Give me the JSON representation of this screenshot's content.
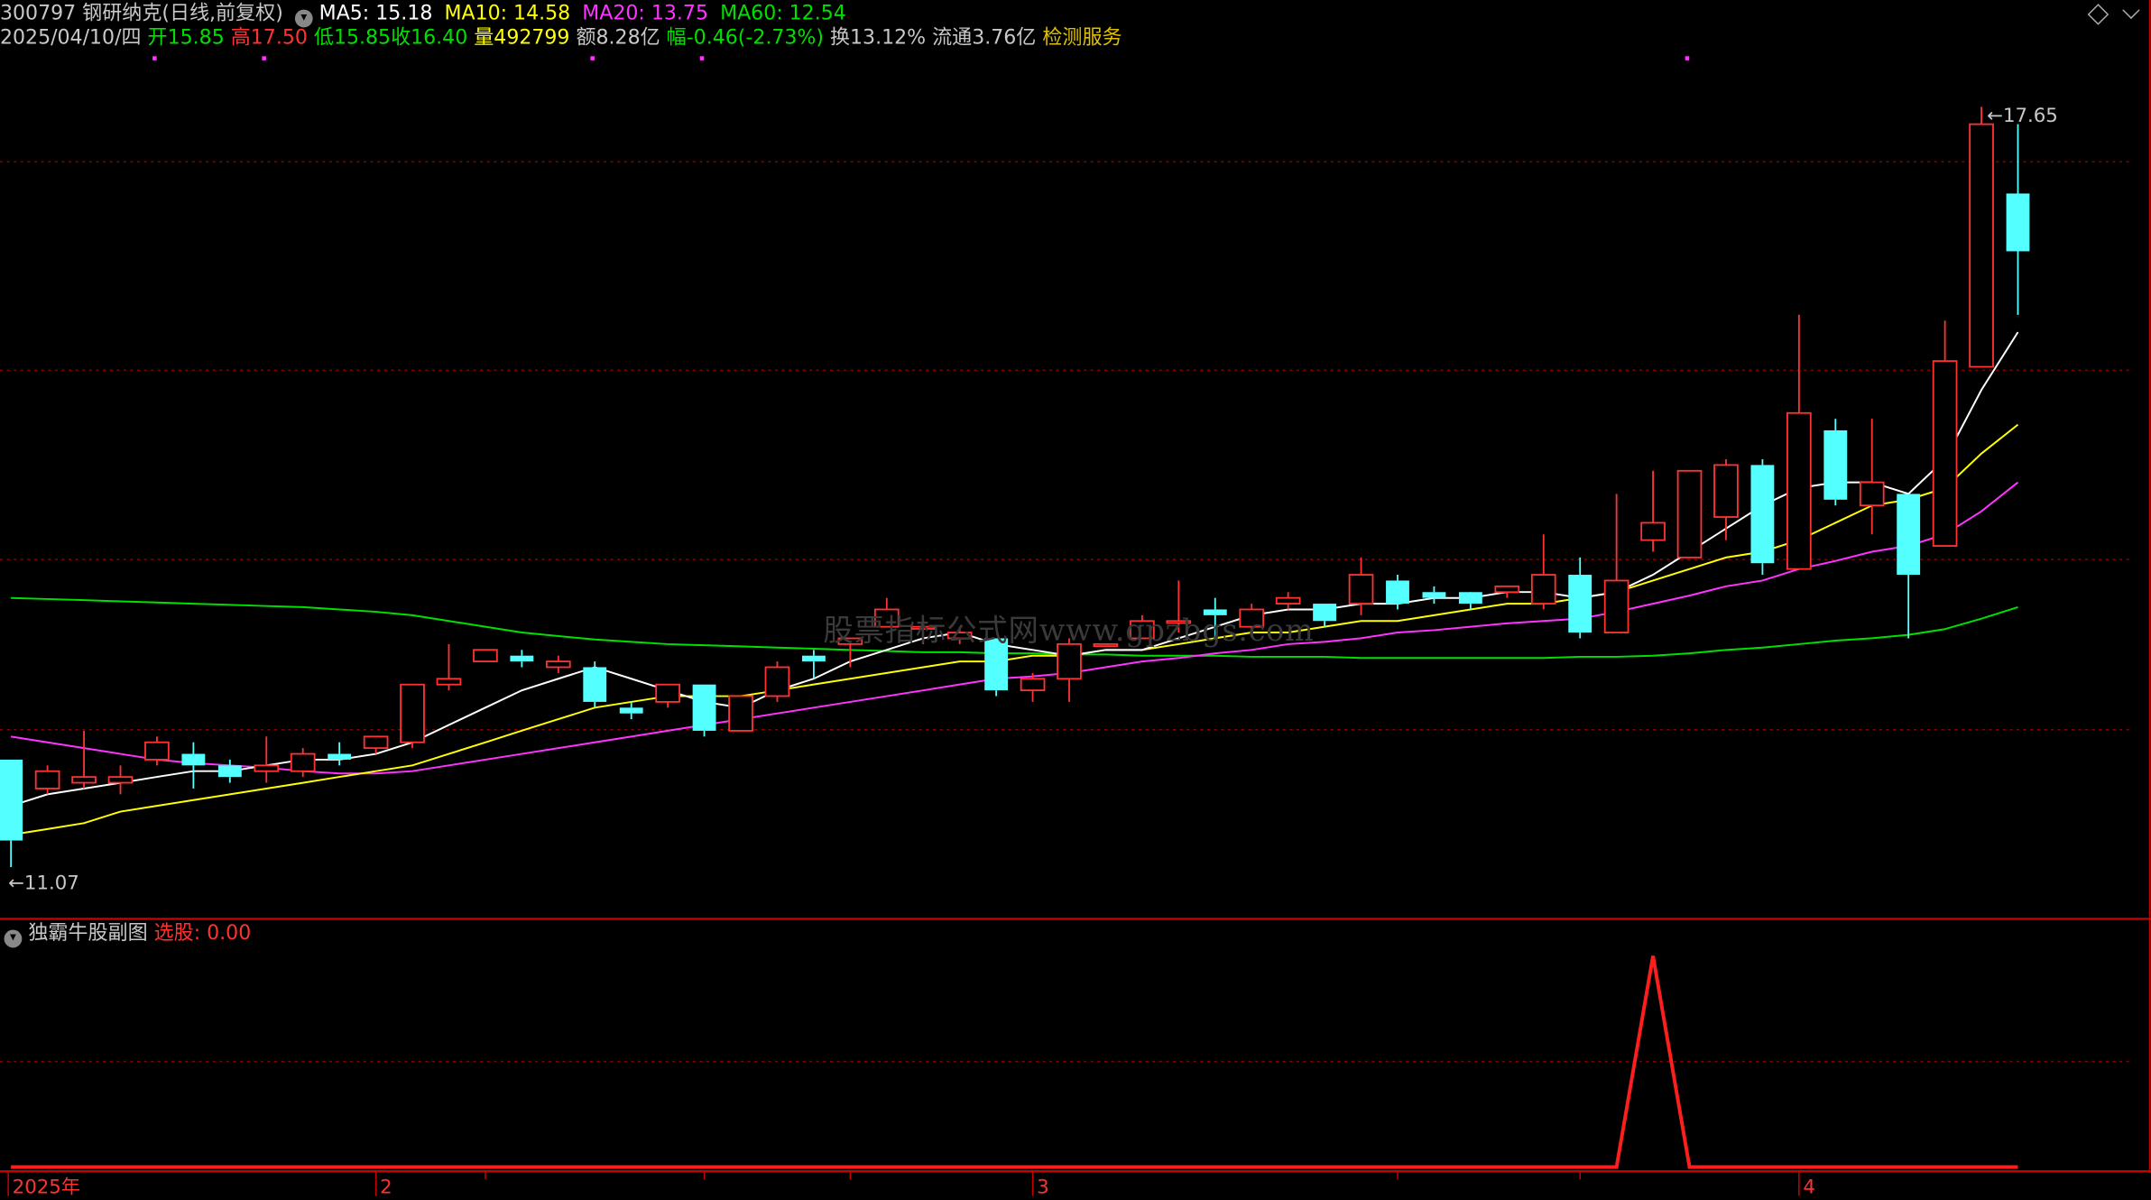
{
  "header": {
    "code": "300797",
    "name": "钢研纳克",
    "period": "(日线,前复权)",
    "ma_labels": [
      {
        "label": "MA5:",
        "value": "15.18",
        "color": "#ffffff"
      },
      {
        "label": "MA10:",
        "value": "14.58",
        "color": "#ffff00"
      },
      {
        "label": "MA20:",
        "value": "13.75",
        "color": "#ff33ff"
      },
      {
        "label": "MA60:",
        "value": "12.54",
        "color": "#00e000"
      }
    ],
    "date": "2025/04/10/四",
    "open_label": "开",
    "open": "15.85",
    "high_label": "高",
    "high": "17.50",
    "low_label": "低",
    "low": "15.85",
    "close_label": "收",
    "close": "16.40",
    "vol_label": "量",
    "vol": "492799",
    "amount_label": "额",
    "amount": "8.28亿",
    "chg_label": "幅",
    "chg": "-0.46(-2.73%)",
    "turnover_label": "换",
    "turnover": "13.12%",
    "float_label": "流通",
    "float": "3.76亿",
    "service": "检测服务"
  },
  "indicator": {
    "name": "独霸牛股副图",
    "label": "选股:",
    "value": "0.00"
  },
  "watermark": "股票指标公式网www.gpzbgs.com",
  "colors": {
    "up": "#ff3232",
    "down": "#54ffff",
    "grid": "#8a0000",
    "ma5": "#ffffff",
    "ma10": "#ffff00",
    "ma20": "#ff33ff",
    "ma60": "#00e000",
    "axis": "#c80000"
  },
  "chart_data": {
    "type": "candlestick",
    "price_range": [
      10.8,
      18.1
    ],
    "high_label": "17.65",
    "low_label": "11.07",
    "x_labels": [
      "2025年",
      "2",
      "3",
      "4"
    ],
    "x_label_index": [
      0,
      10,
      28,
      49
    ],
    "candles": [
      [
        12.0,
        11.3,
        12.0,
        11.07
      ],
      [
        11.75,
        11.9,
        11.95,
        11.7
      ],
      [
        11.8,
        11.85,
        12.25,
        11.75
      ],
      [
        11.8,
        11.85,
        11.95,
        11.7
      ],
      [
        12.0,
        12.15,
        12.2,
        11.95
      ],
      [
        12.05,
        11.95,
        12.15,
        11.75
      ],
      [
        11.95,
        11.85,
        12.0,
        11.8
      ],
      [
        11.9,
        11.95,
        12.2,
        11.8
      ],
      [
        11.9,
        12.05,
        12.1,
        11.85
      ],
      [
        12.05,
        12.0,
        12.15,
        11.95
      ],
      [
        12.1,
        12.2,
        12.2,
        12.05
      ],
      [
        12.15,
        12.65,
        12.65,
        12.1
      ],
      [
        12.65,
        12.7,
        13.0,
        12.6
      ],
      [
        12.85,
        12.95,
        12.95,
        12.85
      ],
      [
        12.9,
        12.85,
        12.95,
        12.8
      ],
      [
        12.8,
        12.85,
        12.9,
        12.75
      ],
      [
        12.8,
        12.5,
        12.85,
        12.45
      ],
      [
        12.45,
        12.4,
        12.5,
        12.35
      ],
      [
        12.5,
        12.65,
        12.65,
        12.45
      ],
      [
        12.65,
        12.25,
        12.65,
        12.2
      ],
      [
        12.25,
        12.55,
        12.55,
        12.25
      ],
      [
        12.55,
        12.8,
        12.85,
        12.5
      ],
      [
        12.9,
        12.85,
        12.95,
        12.7
      ],
      [
        13.0,
        13.05,
        13.05,
        12.8
      ],
      [
        13.15,
        13.3,
        13.4,
        13.15
      ],
      [
        13.15,
        13.15,
        13.2,
        13.0
      ],
      [
        13.05,
        13.1,
        13.15,
        13.0
      ],
      [
        13.05,
        12.6,
        13.05,
        12.55
      ],
      [
        12.6,
        12.7,
        12.75,
        12.5
      ],
      [
        12.7,
        13.0,
        13.05,
        12.5
      ],
      [
        13.0,
        13.0,
        13.0,
        13.0
      ],
      [
        13.05,
        13.2,
        13.25,
        13.05
      ],
      [
        13.2,
        13.2,
        13.55,
        13.1
      ],
      [
        13.3,
        13.25,
        13.4,
        13.05
      ],
      [
        13.15,
        13.3,
        13.35,
        13.1
      ],
      [
        13.35,
        13.4,
        13.45,
        13.3
      ],
      [
        13.35,
        13.2,
        13.35,
        13.15
      ],
      [
        13.35,
        13.6,
        13.75,
        13.25
      ],
      [
        13.55,
        13.35,
        13.6,
        13.3
      ],
      [
        13.45,
        13.4,
        13.5,
        13.35
      ],
      [
        13.45,
        13.35,
        13.4,
        13.3
      ],
      [
        13.45,
        13.5,
        13.5,
        13.4
      ],
      [
        13.35,
        13.6,
        13.95,
        13.3
      ],
      [
        13.6,
        13.1,
        13.75,
        13.05
      ],
      [
        13.1,
        13.55,
        14.3,
        13.1
      ],
      [
        13.9,
        14.05,
        14.5,
        13.8
      ],
      [
        13.75,
        14.5,
        14.5,
        13.75
      ],
      [
        14.1,
        14.55,
        14.6,
        13.9
      ],
      [
        14.55,
        13.7,
        14.6,
        13.6
      ],
      [
        13.65,
        15.0,
        15.85,
        13.65
      ],
      [
        14.85,
        14.25,
        14.95,
        14.2
      ],
      [
        14.2,
        14.4,
        14.95,
        13.95
      ],
      [
        14.3,
        13.6,
        14.3,
        13.05
      ],
      [
        13.85,
        15.45,
        15.8,
        13.85
      ],
      [
        15.4,
        17.5,
        17.65,
        15.4
      ],
      [
        16.9,
        16.4,
        17.5,
        15.85
      ]
    ],
    "ma5": [
      11.6,
      11.7,
      11.75,
      11.8,
      11.85,
      11.9,
      11.9,
      11.95,
      12.0,
      12.0,
      12.05,
      12.15,
      12.3,
      12.45,
      12.6,
      12.7,
      12.8,
      12.7,
      12.6,
      12.5,
      12.45,
      12.6,
      12.7,
      12.85,
      12.95,
      13.05,
      13.1,
      13.0,
      12.95,
      12.9,
      12.95,
      12.95,
      13.05,
      13.15,
      13.25,
      13.3,
      13.3,
      13.35,
      13.35,
      13.4,
      13.4,
      13.45,
      13.45,
      13.4,
      13.45,
      13.6,
      13.8,
      14.0,
      14.2,
      14.35,
      14.4,
      14.4,
      14.3,
      14.6,
      15.2,
      15.7
    ],
    "ma10": [
      11.35,
      11.4,
      11.45,
      11.55,
      11.6,
      11.65,
      11.7,
      11.75,
      11.8,
      11.85,
      11.9,
      11.95,
      12.05,
      12.15,
      12.25,
      12.35,
      12.45,
      12.5,
      12.55,
      12.55,
      12.55,
      12.6,
      12.65,
      12.7,
      12.75,
      12.8,
      12.85,
      12.85,
      12.9,
      12.9,
      12.95,
      12.95,
      13.0,
      13.05,
      13.1,
      13.1,
      13.15,
      13.2,
      13.2,
      13.25,
      13.3,
      13.35,
      13.35,
      13.4,
      13.45,
      13.55,
      13.65,
      13.75,
      13.8,
      13.9,
      14.05,
      14.2,
      14.25,
      14.35,
      14.65,
      14.9
    ],
    "ma20": [
      12.2,
      12.15,
      12.1,
      12.05,
      12.0,
      11.97,
      11.95,
      11.93,
      11.9,
      11.88,
      11.88,
      11.9,
      11.95,
      12.0,
      12.05,
      12.1,
      12.15,
      12.2,
      12.25,
      12.3,
      12.35,
      12.4,
      12.45,
      12.5,
      12.55,
      12.6,
      12.65,
      12.7,
      12.72,
      12.75,
      12.8,
      12.85,
      12.88,
      12.92,
      12.95,
      13.0,
      13.02,
      13.05,
      13.1,
      13.12,
      13.15,
      13.18,
      13.2,
      13.22,
      13.28,
      13.35,
      13.42,
      13.5,
      13.55,
      13.65,
      13.72,
      13.8,
      13.85,
      13.95,
      14.15,
      14.4
    ],
    "ma60": [
      13.4,
      13.39,
      13.38,
      13.37,
      13.36,
      13.35,
      13.34,
      13.33,
      13.32,
      13.3,
      13.28,
      13.25,
      13.2,
      13.15,
      13.1,
      13.07,
      13.04,
      13.02,
      13.0,
      12.99,
      12.98,
      12.97,
      12.96,
      12.95,
      12.94,
      12.93,
      12.93,
      12.92,
      12.92,
      12.91,
      12.91,
      12.9,
      12.9,
      12.9,
      12.89,
      12.89,
      12.89,
      12.88,
      12.88,
      12.88,
      12.88,
      12.88,
      12.88,
      12.89,
      12.89,
      12.9,
      12.92,
      12.95,
      12.97,
      13.0,
      13.03,
      13.05,
      13.08,
      13.13,
      13.22,
      13.32
    ],
    "indicator_values": [
      0,
      0,
      0,
      0,
      0,
      0,
      0,
      0,
      0,
      0,
      0,
      0,
      0,
      0,
      0,
      0,
      0,
      0,
      0,
      0,
      0,
      0,
      0,
      0,
      0,
      0,
      0,
      0,
      0,
      0,
      0,
      0,
      0,
      0,
      0,
      0,
      0,
      0,
      0,
      0,
      0,
      0,
      0,
      0,
      0,
      1,
      0,
      0,
      0,
      0,
      0,
      0,
      0,
      0,
      0,
      0
    ],
    "signal_marks": [
      2,
      5,
      14,
      17,
      44
    ]
  }
}
